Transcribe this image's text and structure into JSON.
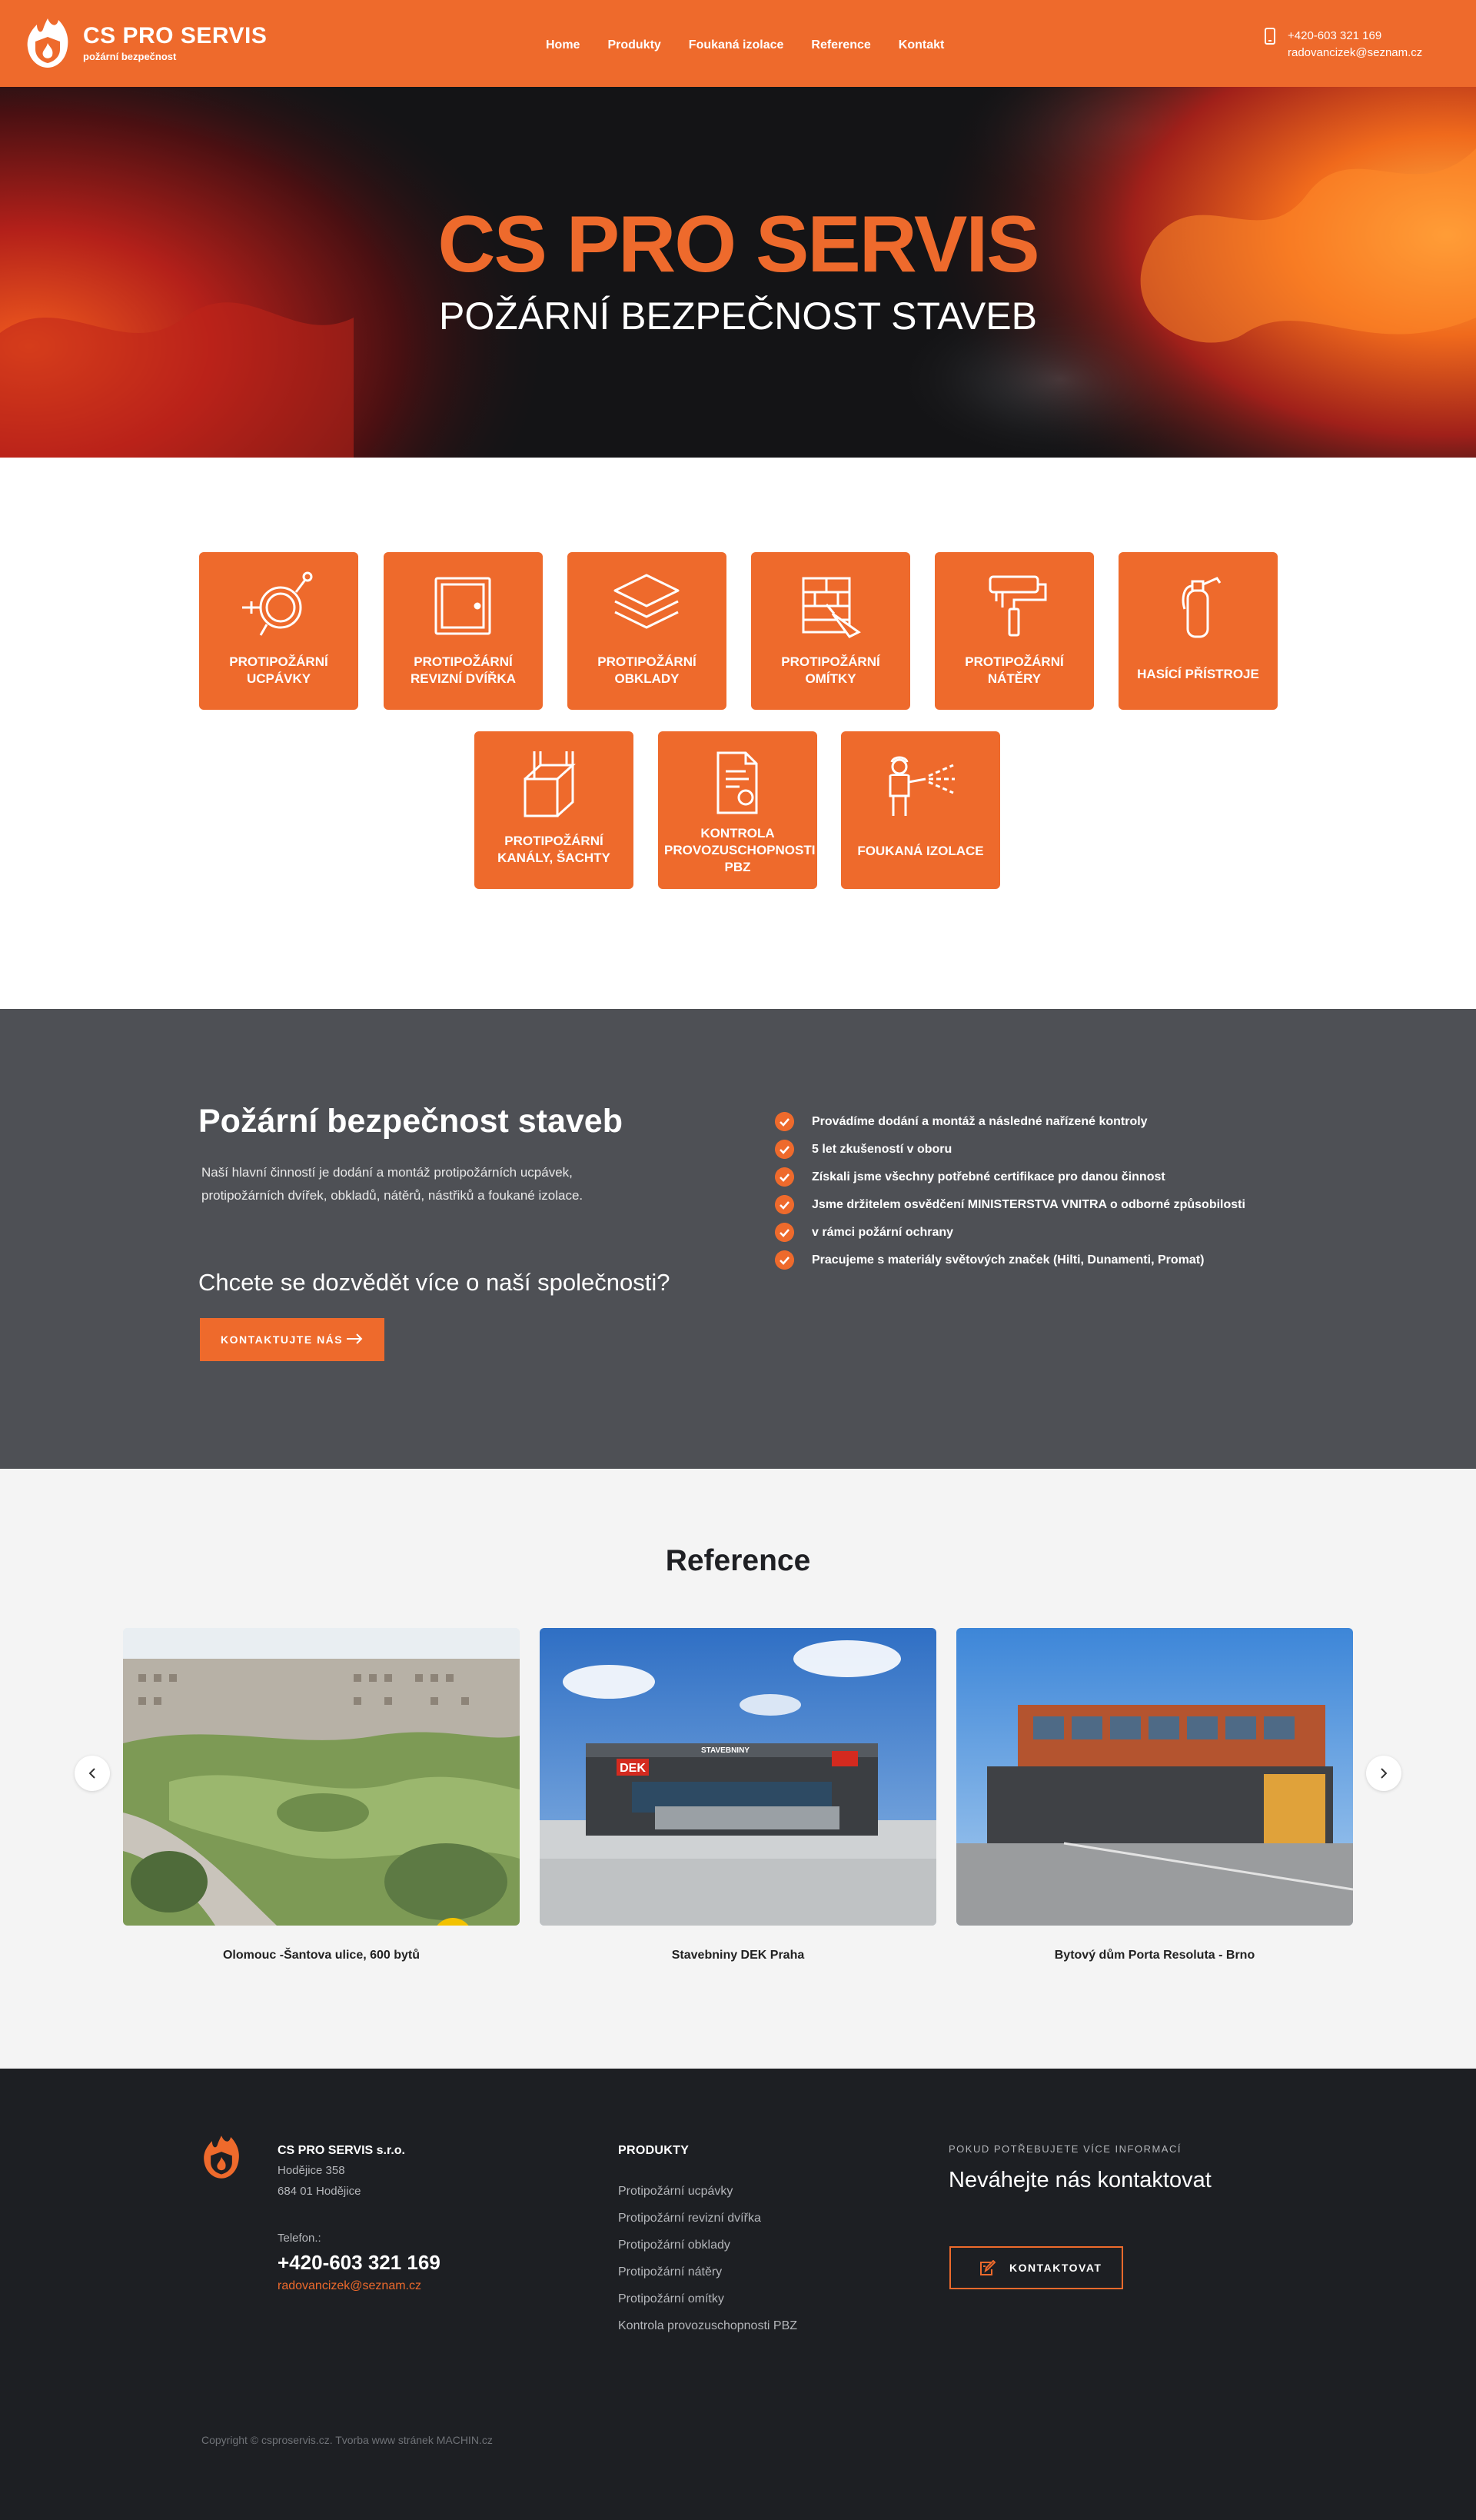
{
  "header": {
    "brand_name": "CS PRO SERVIS",
    "brand_sub": "požární bezpečnost",
    "nav": [
      "Home",
      "Produkty",
      "Foukaná izolace",
      "Reference",
      "Kontakt"
    ],
    "phone": "+420-603 321 169",
    "email": "radovancizek@seznam.cz"
  },
  "hero": {
    "title": "CS PRO SERVIS",
    "subtitle": "POŽÁRNÍ BEZPEČNOST STAVEB"
  },
  "services": [
    {
      "label": "PROTIPOŽÁRNÍ UCPÁVKY",
      "icon": "pipe-seal-icon"
    },
    {
      "label": "PROTIPOŽÁRNÍ REVIZNÍ DVÍŘKA",
      "icon": "door-icon"
    },
    {
      "label": "PROTIPOŽÁRNÍ OBKLADY",
      "icon": "layers-icon"
    },
    {
      "label": "PROTIPOŽÁRNÍ OMÍTKY",
      "icon": "brick-trowel-icon"
    },
    {
      "label": "PROTIPOŽÁRNÍ NÁTĚRY",
      "icon": "paint-roller-icon"
    },
    {
      "label": "HASÍCÍ PŘÍSTROJE",
      "icon": "fire-extinguisher-icon"
    },
    {
      "label": "PROTIPOŽÁRNÍ KANÁLY, ŠACHTY",
      "icon": "shaft-box-icon"
    },
    {
      "label": "KONTROLA PROVOZUSCHOPNOSTI PBZ",
      "icon": "certificate-icon"
    },
    {
      "label": "FOUKANÁ IZOLACE",
      "icon": "spray-worker-icon"
    }
  ],
  "about": {
    "title": "Požární bezpečnost staveb",
    "description": "Naší hlavní činností je dodání a montáž protipožárních ucpávek, protipožárních dvířek, obkladů, nátěrů, nástřiků a foukané izolace.",
    "question": "Chcete se dozvědět více o naší společnosti?",
    "button": "KONTAKTUJTE NÁS",
    "points": [
      "Provádíme dodání a montáž a následné nařízené kontroly",
      "5 let zkušeností v oboru",
      "Získali jsme všechny potřebné certifikace pro danou činnost",
      "Jsme držitelem osvědčení MINISTERSTVA VNITRA o odborné způsobilosti",
      "v rámci požární ochrany",
      "Pracujeme s materiály světových značek (Hilti, Dunamenti, Promat)"
    ]
  },
  "references": {
    "title": "Reference",
    "items": [
      {
        "caption": "Olomouc -Šantova ulice, 600 bytů"
      },
      {
        "caption": "Stavebniny DEK Praha",
        "sign": "DEK",
        "sign2": "STAVEBNINY"
      },
      {
        "caption": "Bytový dům Porta Resoluta - Brno"
      }
    ],
    "plus": "+"
  },
  "footer": {
    "company": "CS PRO SERVIS s.r.o.",
    "address1": "Hodějice 358",
    "address2": "684 01 Hodějice",
    "phone_label": "Telefon.:",
    "phone": "+420-603 321 169",
    "email": "radovancizek@seznam.cz",
    "products_title": "PRODUKTY",
    "products": [
      "Protipožární ucpávky",
      "Protipožární revizní dvířka",
      "Protipožární obklady",
      "Protipožární nátěry",
      "Protipožární omítky",
      "Kontrola provozuschopnosti PBZ"
    ],
    "info_title": "POKUD POTŘEBUJETE VÍCE INFORMACÍ",
    "info_text": "Neváhejte nás kontaktovat",
    "button": "KONTAKTOVAT",
    "copyright": "Copyright © csproservis.cz. Tvorba www stránek MACHIN.cz"
  },
  "colors": {
    "accent": "#ee6a2c",
    "dark_section": "#4e5055",
    "footer": "#1d1f23",
    "light_section": "#f4f4f4"
  }
}
